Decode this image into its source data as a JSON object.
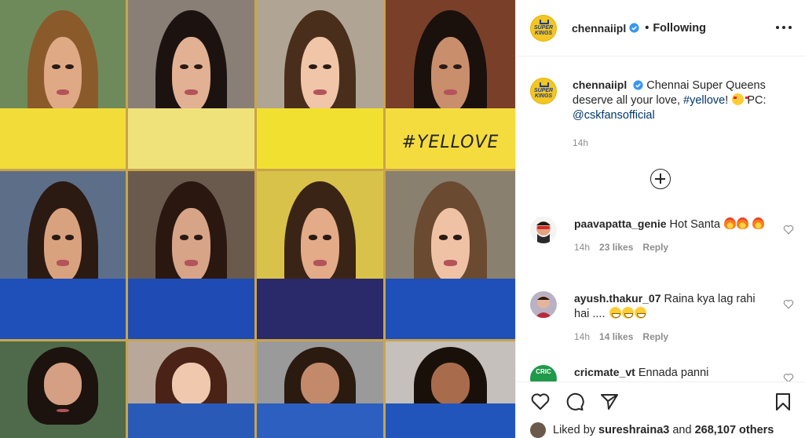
{
  "post": {
    "account": "chennaiipl",
    "follow_status": "Following",
    "separator": "•",
    "avatar_text": "SUPER KINGS",
    "caption_parts": [
      "Chennai Super Queens deserve all your love, ",
      "#yellove",
      "! ",
      " PC: ",
      "@cskfansofficial"
    ],
    "caption_time": "14h",
    "liked_by_prefix": "Liked by",
    "liked_by_user": "sureshraina3",
    "liked_by_and": "and",
    "liked_by_others": "268,107 others",
    "shirt_text": "#YELLOVE"
  },
  "comments": [
    {
      "user": "paavapatta_genie",
      "text": "Hot Santa",
      "time": "14h",
      "likes": "23 likes",
      "reply": "Reply"
    },
    {
      "user": "ayush.thakur_07",
      "text": "Raina kya lag rahi hai ....",
      "time": "14h",
      "likes": "14 likes",
      "reply": "Reply"
    },
    {
      "user": "cricmate_vt",
      "text": "Ennada panni",
      "avatar_text": "CRIC"
    }
  ],
  "colors": {
    "link": "#00376b",
    "verified": "#3897f0",
    "csk_yellow": "#f3c623",
    "meta_gray": "#8e8e8e",
    "grid_gold": "#c9a44c"
  },
  "icons": [
    "more-options-icon",
    "verified-badge-icon",
    "load-more-icon",
    "heart-icon",
    "comment-icon",
    "share-icon",
    "save-icon"
  ]
}
